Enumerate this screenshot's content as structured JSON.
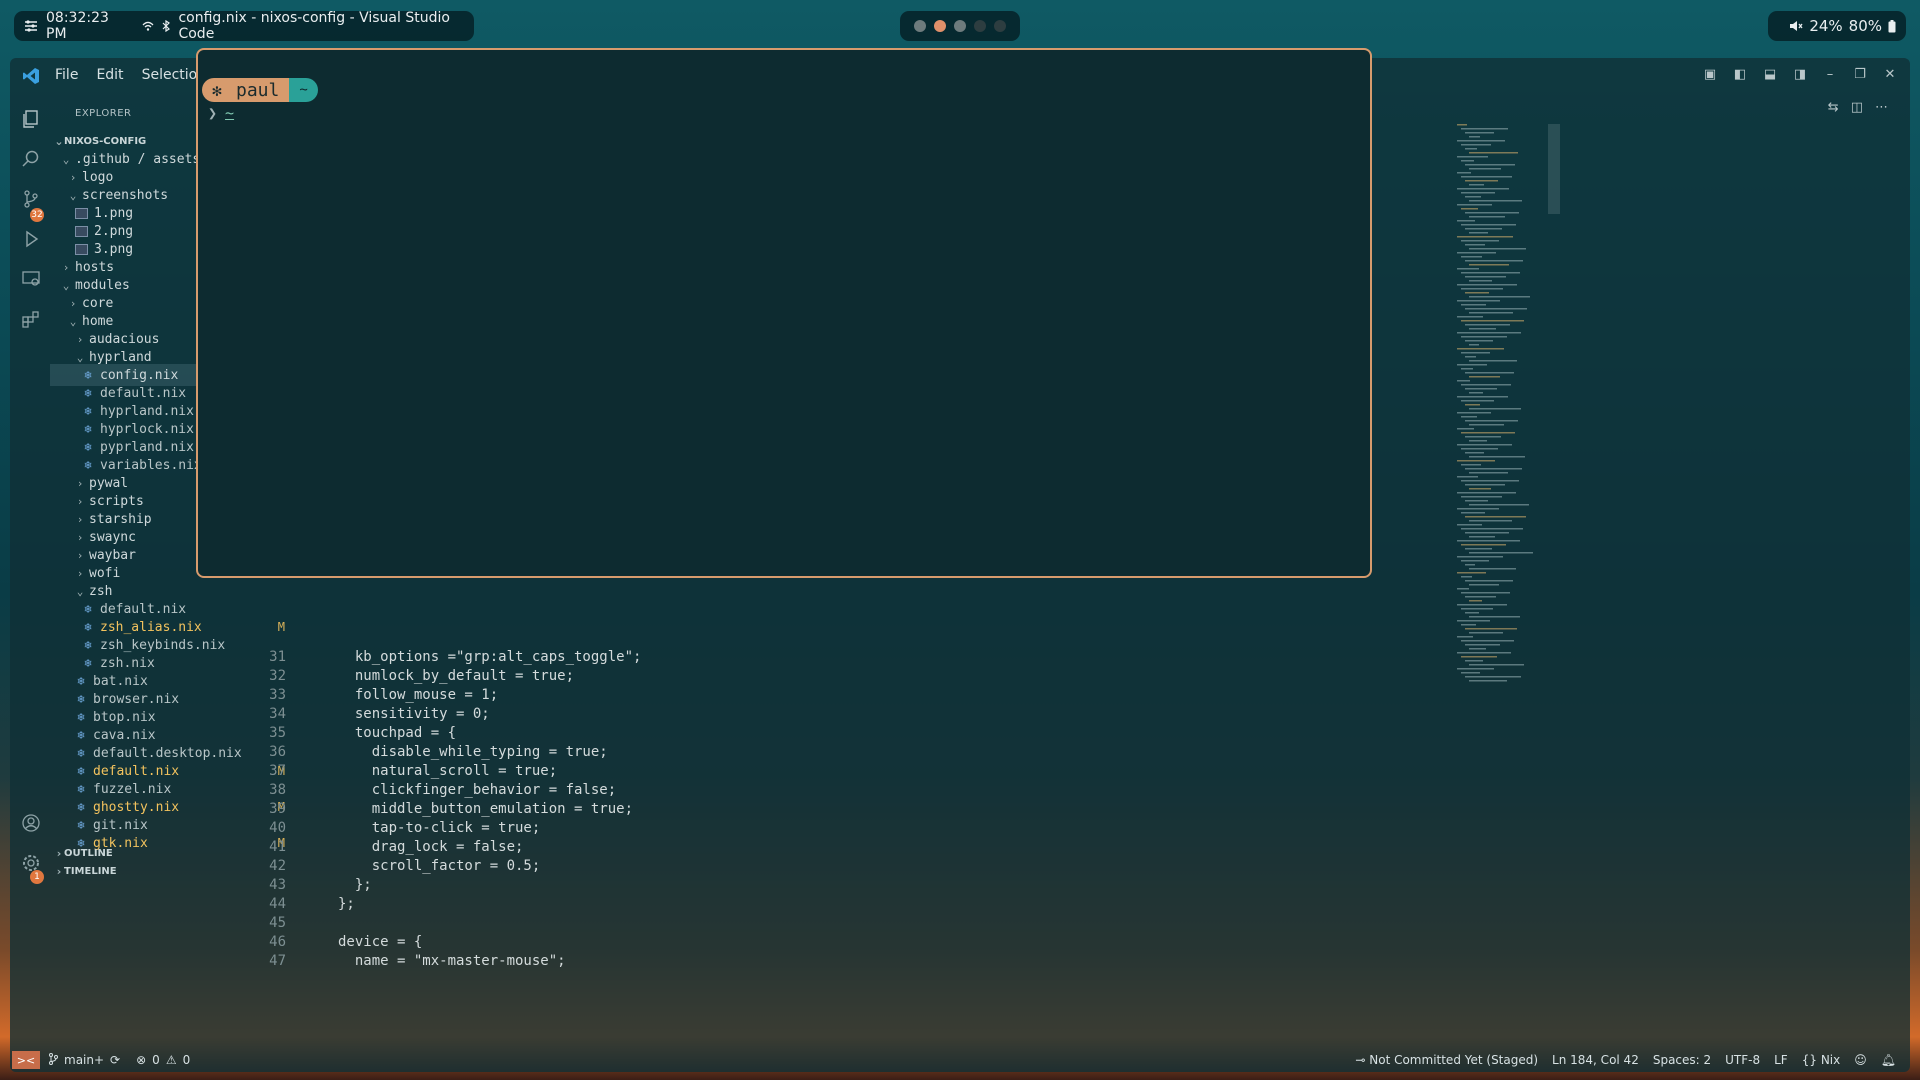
{
  "topbar": {
    "time": "08:32:23 PM",
    "window_title": "config.nix - nixos-config - Visual Studio Code",
    "volume": "24%",
    "battery": "80%"
  },
  "window": {
    "menu": [
      "File",
      "Edit",
      "Selection"
    ]
  },
  "explorer": {
    "title": "EXPLORER",
    "root": "NIXOS-CONFIG",
    "items": [
      {
        "label": ".github / assets",
        "indent": 1,
        "type": "folder-open"
      },
      {
        "label": "logo",
        "indent": 2,
        "type": "folder"
      },
      {
        "label": "screenshots",
        "indent": 2,
        "type": "folder-open"
      },
      {
        "label": "1.png",
        "indent": 3,
        "type": "png"
      },
      {
        "label": "2.png",
        "indent": 3,
        "type": "png"
      },
      {
        "label": "3.png",
        "indent": 3,
        "type": "png"
      },
      {
        "label": "hosts",
        "indent": 1,
        "type": "folder"
      },
      {
        "label": "modules",
        "indent": 1,
        "type": "folder-open"
      },
      {
        "label": "core",
        "indent": 2,
        "type": "folder"
      },
      {
        "label": "home",
        "indent": 2,
        "type": "folder-open"
      },
      {
        "label": "audacious",
        "indent": 3,
        "type": "folder"
      },
      {
        "label": "hyprland",
        "indent": 3,
        "type": "folder-open"
      },
      {
        "label": "config.nix",
        "indent": 4,
        "type": "nix",
        "selected": true
      },
      {
        "label": "default.nix",
        "indent": 4,
        "type": "nix"
      },
      {
        "label": "hyprland.nix",
        "indent": 4,
        "type": "nix"
      },
      {
        "label": "hyprlock.nix",
        "indent": 4,
        "type": "nix"
      },
      {
        "label": "pyprland.nix",
        "indent": 4,
        "type": "nix"
      },
      {
        "label": "variables.nix",
        "indent": 4,
        "type": "nix"
      },
      {
        "label": "pywal",
        "indent": 3,
        "type": "folder"
      },
      {
        "label": "scripts",
        "indent": 3,
        "type": "folder"
      },
      {
        "label": "starship",
        "indent": 3,
        "type": "folder"
      },
      {
        "label": "swaync",
        "indent": 3,
        "type": "folder"
      },
      {
        "label": "waybar",
        "indent": 3,
        "type": "folder"
      },
      {
        "label": "wofi",
        "indent": 3,
        "type": "folder"
      },
      {
        "label": "zsh",
        "indent": 3,
        "type": "folder-open"
      },
      {
        "label": "default.nix",
        "indent": 4,
        "type": "nix"
      },
      {
        "label": "zsh_alias.nix",
        "indent": 4,
        "type": "nix",
        "mark": "M"
      },
      {
        "label": "zsh_keybinds.nix",
        "indent": 4,
        "type": "nix"
      },
      {
        "label": "zsh.nix",
        "indent": 4,
        "type": "nix"
      },
      {
        "label": "bat.nix",
        "indent": 3,
        "type": "nix"
      },
      {
        "label": "browser.nix",
        "indent": 3,
        "type": "nix"
      },
      {
        "label": "btop.nix",
        "indent": 3,
        "type": "nix"
      },
      {
        "label": "cava.nix",
        "indent": 3,
        "type": "nix"
      },
      {
        "label": "default.desktop.nix",
        "indent": 3,
        "type": "nix"
      },
      {
        "label": "default.nix",
        "indent": 3,
        "type": "nix",
        "mark": "M"
      },
      {
        "label": "fuzzel.nix",
        "indent": 3,
        "type": "nix"
      },
      {
        "label": "ghostty.nix",
        "indent": 3,
        "type": "nix",
        "mark": "M"
      },
      {
        "label": "git.nix",
        "indent": 3,
        "type": "nix"
      },
      {
        "label": "gtk.nix",
        "indent": 3,
        "type": "nix",
        "mark": "M"
      }
    ],
    "sections": [
      "OUTLINE",
      "TIMELINE"
    ],
    "scm_badge": "32",
    "settings_badge": "1"
  },
  "code": {
    "lines": [
      {
        "n": "31",
        "t": "  kb_options =\"grp:alt_caps_toggle\";"
      },
      {
        "n": "32",
        "t": "  numlock_by_default = true;"
      },
      {
        "n": "33",
        "t": "  follow_mouse = 1;"
      },
      {
        "n": "34",
        "t": "  sensitivity = 0;"
      },
      {
        "n": "35",
        "t": "  touchpad = {"
      },
      {
        "n": "36",
        "t": "    disable_while_typing = true;"
      },
      {
        "n": "37",
        "t": "    natural_scroll = true;"
      },
      {
        "n": "38",
        "t": "    clickfinger_behavior = false;"
      },
      {
        "n": "39",
        "t": "    middle_button_emulation = true;"
      },
      {
        "n": "40",
        "t": "    tap-to-click = true;"
      },
      {
        "n": "41",
        "t": "    drag_lock = false;"
      },
      {
        "n": "42",
        "t": "    scroll_factor = 0.5;"
      },
      {
        "n": "43",
        "t": "  };"
      },
      {
        "n": "44",
        "t": "};"
      },
      {
        "n": "45",
        "t": ""
      },
      {
        "n": "46",
        "t": "device = {"
      },
      {
        "n": "47",
        "t": "  name = \"mx-master-mouse\";"
      }
    ]
  },
  "terminal": {
    "user": "paul",
    "dir": "~",
    "line2_dir": "~"
  },
  "statusbar": {
    "branch": "main+",
    "errors": "0",
    "warnings": "0",
    "commit_status": "Not Committed Yet (Staged)",
    "position": "Ln 184, Col 42",
    "spaces": "Spaces: 2",
    "encoding": "UTF-8",
    "eol": "LF",
    "language": "Nix"
  },
  "colors": {
    "accent": "#d79b6d",
    "teal": "#2aa198",
    "modified": "#f3c35e"
  }
}
